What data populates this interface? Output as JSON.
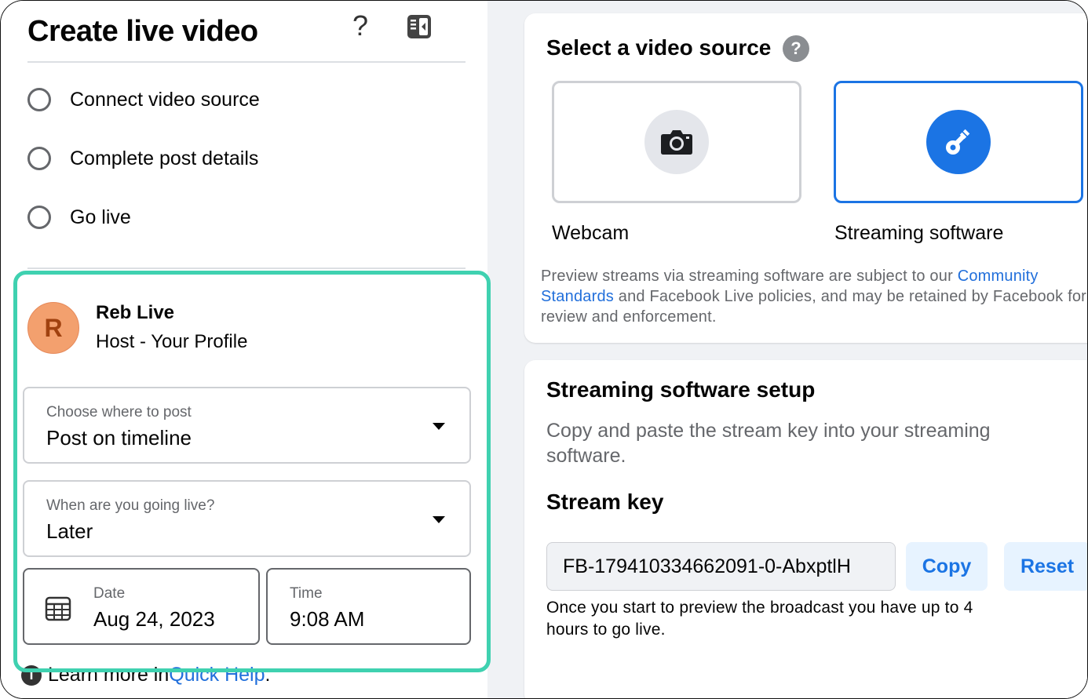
{
  "left": {
    "title": "Create live video",
    "help_icon": "question-mark",
    "panel_icon": "sidebar-toggle-icon",
    "steps": [
      {
        "label": "Connect video source"
      },
      {
        "label": "Complete post details"
      },
      {
        "label": "Go live"
      }
    ],
    "host": {
      "initial": "R",
      "name": "Reb Live",
      "role": "Host - Your Profile"
    },
    "post_where": {
      "label": "Choose where to post",
      "value": "Post on timeline"
    },
    "going_live": {
      "label": "When are you going live?",
      "value": "Later"
    },
    "date": {
      "label": "Date",
      "value": "Aug 24, 2023"
    },
    "time": {
      "label": "Time",
      "value": "9:08 AM"
    },
    "learn_more": {
      "prefix": "Learn more in ",
      "link": "Quick Help",
      "suffix": "."
    }
  },
  "source": {
    "title": "Select a video source",
    "help_badge": "?",
    "options": [
      {
        "label": "Webcam",
        "icon": "camera-icon",
        "selected": false
      },
      {
        "label": "Streaming software",
        "icon": "key-icon",
        "selected": true
      }
    ],
    "note_prefix": "Preview streams via streaming software are subject to our ",
    "note_link": "Community Standards",
    "note_suffix": " and Facebook Live policies, and may be retained by Facebook for review and enforcement."
  },
  "setup": {
    "title": "Streaming software setup",
    "description": "Copy and paste the stream key into your streaming software.",
    "key_title": "Stream key",
    "key_value": "FB-179410334662091-0-AbxptlH",
    "copy_label": "Copy",
    "reset_label": "Reset",
    "key_note": "Once you start to preview the broadcast you have up to 4 hours to go live."
  },
  "colors": {
    "accent": "#1b74e4",
    "highlight": "#3fd1b0",
    "avatar": "#f3a06e"
  }
}
